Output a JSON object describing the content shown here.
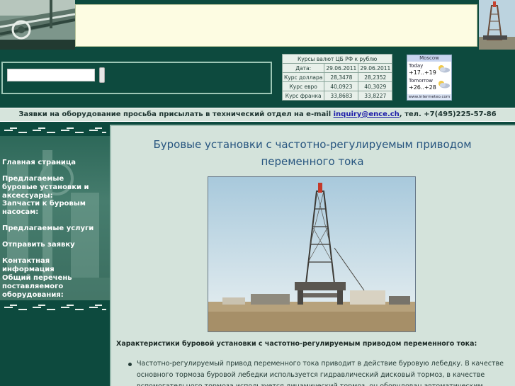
{
  "search": {
    "placeholder": "",
    "button_label": ""
  },
  "fx_table": {
    "caption": "Курсы валют ЦБ РФ к рублю",
    "header": [
      "Дата:",
      "29.06.2011",
      "29.06.2011"
    ],
    "rows": [
      [
        "Курс доллара",
        "28,3478",
        "28,2352"
      ],
      [
        "Курс евро",
        "40,0923",
        "40,3029"
      ],
      [
        "Курс франка",
        "33,8683",
        "33,8227"
      ]
    ]
  },
  "weather": {
    "city": "Moscow",
    "today_label": "Today",
    "today_temp": "+17..+19",
    "tomorrow_label": "Tomorrow",
    "tomorrow_temp": "+26..+28",
    "credit": "www.intermeteo.com"
  },
  "notice": {
    "text_before": "Заявки на оборудование просьба присылать в технический отдел на e-mail ",
    "email": "inquiry@ence.ch",
    "text_after": ", тел. +7(495)225-57-86"
  },
  "nav": {
    "items": [
      "Главная страница",
      "Предлагаемые буровые установки и аксессуары:",
      "Запчасти к буровым насосам:",
      "Предлагаемые услуги",
      "Отправить заявку",
      "Контактная информация",
      "Общий перечень поставляемого оборудования:"
    ]
  },
  "main": {
    "title": "Буровые установки с частотно-регулируемым приводом переменного тока",
    "subheading": "Характеристики буровой установки с частотно-регулируемым приводом переменного тока:",
    "bullet": "Частотно-регулируемый привод переменного тока приводит в действие буровую лебедку. В качестве основного тормоза буровой лебедки используется гидравлический дисковый тормоз, в качестве вспомогательного тормоза используется динамический тормоз, он оборудован автоматическим подающим"
  }
}
